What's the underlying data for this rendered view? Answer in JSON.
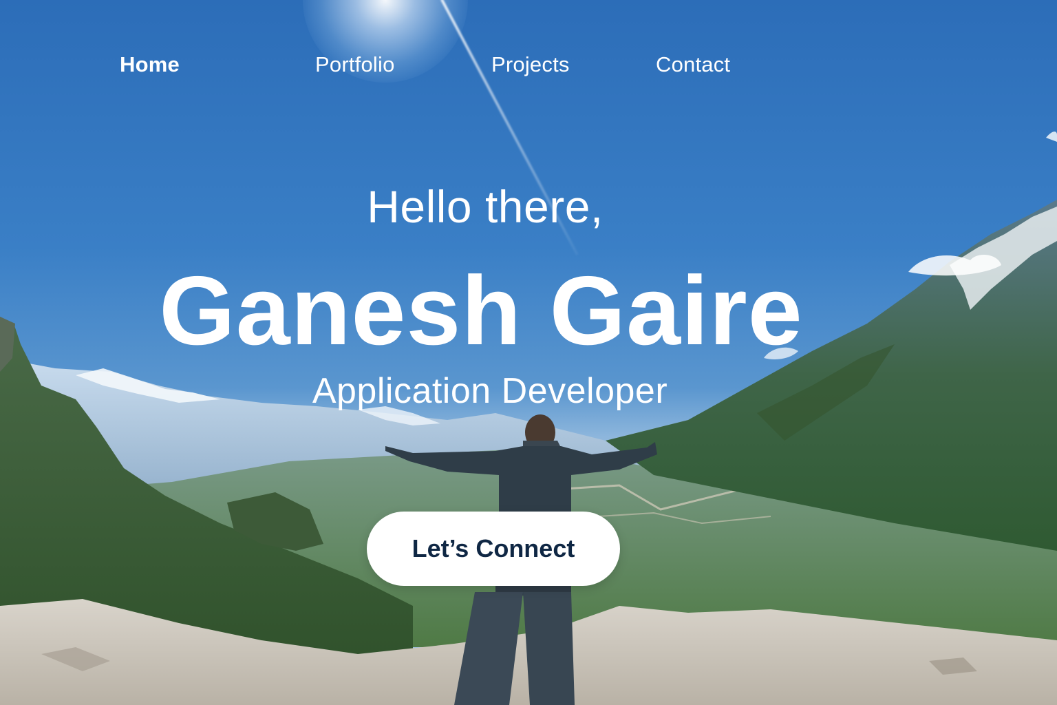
{
  "nav": {
    "items": [
      {
        "label": "Home",
        "active": true
      },
      {
        "label": "Portfolio",
        "active": false
      },
      {
        "label": "Projects",
        "active": false
      },
      {
        "label": "Contact",
        "active": false
      }
    ]
  },
  "hero": {
    "greeting": "Hello there,",
    "name": "Ganesh Gaire",
    "role": "Application Developer",
    "cta_label": "Let’s Connect"
  },
  "colors": {
    "sky": "#2c6db8",
    "text": "#ffffff",
    "button_bg": "#ffffff",
    "button_text": "#0f2744"
  }
}
